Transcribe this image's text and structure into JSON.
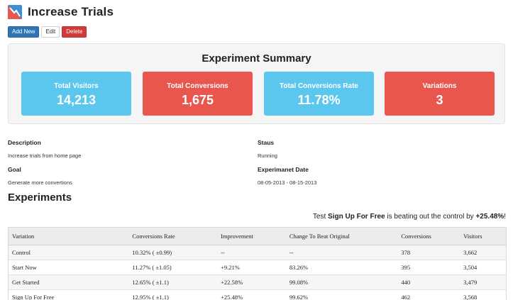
{
  "header": {
    "title": "Increase Trials",
    "logo_icon": "logo-icon"
  },
  "toolbar": {
    "add_label": "Add New",
    "edit_label": "Edit",
    "delete_label": "Delete"
  },
  "summary": {
    "title": "Experiment Summary",
    "cards": [
      {
        "label": "Total Visitors",
        "value": "14,213",
        "color": "#5bc7ef"
      },
      {
        "label": "Total Conversions",
        "value": "1,675",
        "color": "#e8564d"
      },
      {
        "label": "Total Conversions Rate",
        "value": "11.78%",
        "color": "#5bc7ef"
      },
      {
        "label": "Variations",
        "value": "3",
        "color": "#e8564d"
      }
    ]
  },
  "details": {
    "description_label": "Description",
    "description_value": "Increase trials from home page",
    "goal_label": "Goal",
    "goal_value": "Generate more convertions",
    "status_label": "Staus",
    "status_value": "Running",
    "date_label": "Experimanet Date",
    "date_value": "08-05-2013 - 08-15-2013"
  },
  "experiments": {
    "title": "Experiments",
    "beat_prefix": "Test ",
    "beat_variation": "Sign Up For Free",
    "beat_middle": " is beating out the control by ",
    "beat_value": "+25.48%",
    "beat_suffix": "!",
    "columns": [
      "Variation",
      "Conversions Rate",
      "Improvement",
      "Change To Beat Original",
      "Conversions",
      "Visitors"
    ],
    "rows": [
      [
        "Control",
        "10.32% ( ±0.99)",
        "--",
        "--",
        "378",
        "3,662"
      ],
      [
        "Start Now",
        "11.27% ( ±1.05)",
        "+9.21%",
        "83.26%",
        "395",
        "3,504"
      ],
      [
        "Get Started",
        "12.65% ( ±1.1)",
        "+22.58%",
        "99.08%",
        "440",
        "3,479"
      ],
      [
        "Sign Up For Free",
        "12.95% ( ±1.1)",
        "+25.48%",
        "99.62%",
        "462",
        "3,568"
      ]
    ]
  }
}
